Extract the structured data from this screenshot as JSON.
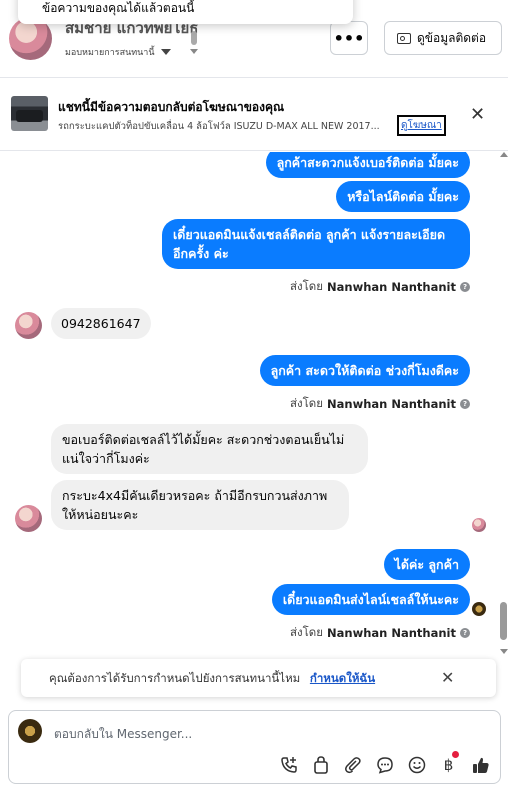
{
  "tooltip": {
    "text": "ข้อความของคุณได้แล้วตอนนี้"
  },
  "header": {
    "contact_name": "สมชาย แก้วทิพย์โยธิ",
    "assign_label": "มอบหมายการสนทนานี้",
    "more_label": "•••",
    "contact_info_label": "ดูข้อมูลติดต่อ"
  },
  "ad": {
    "title": "แชทนี้มีข้อความตอบกลับต่อโฆษณาของคุณ",
    "description": "รถกระบะแคปตัวท็อปขับเคลื่อน 4 ล้อโฟว์ล ISUZU D-MAX ALL NEW 2017...",
    "link_label": "ดูโฆษณา",
    "close": "✕"
  },
  "messages": [
    {
      "from": "page",
      "text": "ลูกค้าสะดวกแจ้งเบอร์ติดต่อ มั้ยคะ"
    },
    {
      "from": "page",
      "text": "หรือไลน์ติดต่อ มั้ยคะ"
    },
    {
      "from": "page",
      "text": "เดี๋ยวแอดมินแจ้งเชลล์ติดต่อ ลูกค้า แจ้งรายละเอียดอีกครั้ง ค่ะ"
    },
    {
      "from": "user",
      "text": "0942861647"
    },
    {
      "from": "page",
      "text": "ลูกค้า สะดวให้ติดต่อ ช่วงกี่โมงดีคะ"
    },
    {
      "from": "user",
      "text": "ขอเบอร์ติดต่อเชลล์ไว้ได้มั้ยคะ สะดวกช่วงตอนเย็นไม่แน่ใจว่ากี่โมงค่ะ"
    },
    {
      "from": "user",
      "text": "กระบะ4x4มีคันเดียวหรอคะ ถ้ามีอีกรบกวนส่งภาพให้หน่อยนะคะ"
    },
    {
      "from": "page",
      "text": "ได้ค่ะ ลูกค้า"
    },
    {
      "from": "page",
      "text": "เดี๋ยวแอดมินส่งไลน์เชลล์ให้นะคะ"
    }
  ],
  "sent_by": {
    "prefix": "ส่งโดย",
    "name": "Nanwhan Nanthanit"
  },
  "reminder": {
    "text": "คุณต้องการได้รับการกำหนดไปยังการสนทนานี้ไหม",
    "link": "กำหนดให้ฉัน",
    "close": "✕"
  },
  "composer": {
    "placeholder": "ตอบกลับใน Messenger..."
  },
  "tool_icons": [
    "phone-plus-icon",
    "bag-icon",
    "paperclip-icon",
    "chat-icon",
    "emoji-icon",
    "baht-icon",
    "thumbs-up-icon"
  ],
  "colors": {
    "accent": "#0a7cff",
    "link": "#1a57c8",
    "badge": "#e41e3f"
  }
}
